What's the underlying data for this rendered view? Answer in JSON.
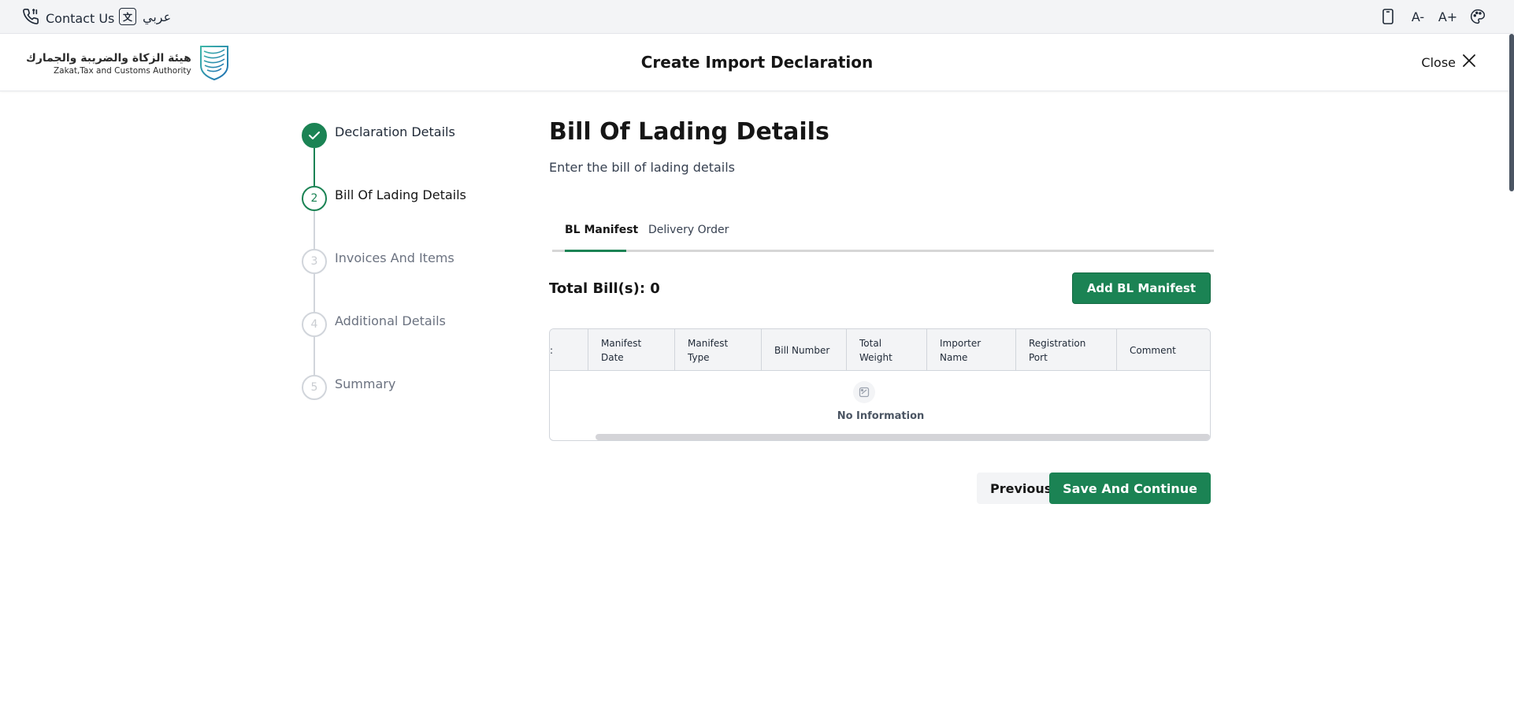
{
  "topbar": {
    "contact_label": "Contact Us",
    "language_label": "عربي",
    "icons": [
      "phone-icon",
      "translate-icon",
      "mobile-icon",
      "font-decrease-icon",
      "font-increase-icon",
      "palette-icon"
    ],
    "font_decrease": "A-",
    "font_increase": "A+"
  },
  "header": {
    "brand_ar": "هيئة الزكاة والضريبة والجمارك",
    "brand_en": "Zakat,Tax and Customs Authority",
    "title": "Create Import Declaration",
    "close_label": "Close"
  },
  "steps": [
    {
      "number": "1",
      "label": "Declaration Details",
      "status": "completed"
    },
    {
      "number": "2",
      "label": "Bill Of Lading Details",
      "status": "active"
    },
    {
      "number": "3",
      "label": "Invoices And Items",
      "status": "pending"
    },
    {
      "number": "4",
      "label": "Additional Details",
      "status": "pending"
    },
    {
      "number": "5",
      "label": "Summary",
      "status": "pending"
    }
  ],
  "main": {
    "title": "Bill Of Lading Details",
    "subtitle": "Enter the bill of lading details",
    "tabs": [
      {
        "label": "BL Manifest",
        "active": true
      },
      {
        "label": "Delivery Order",
        "active": false
      }
    ],
    "total_label": "Total Bill(s): 0",
    "add_button": "Add BL Manifest",
    "table": {
      "partial_header": ":",
      "columns": [
        "Manifest Date",
        "Manifest Type",
        "Bill Number",
        "Total Weight",
        "Importer Name",
        "Registration Port",
        "Comment"
      ],
      "empty_text": "No Information"
    },
    "previous_button": "Previous",
    "save_button": "Save And Continue"
  },
  "colors": {
    "primary": "#1b8354",
    "pending": "#d1d5db",
    "topbar_bg": "#f3f4f6"
  }
}
